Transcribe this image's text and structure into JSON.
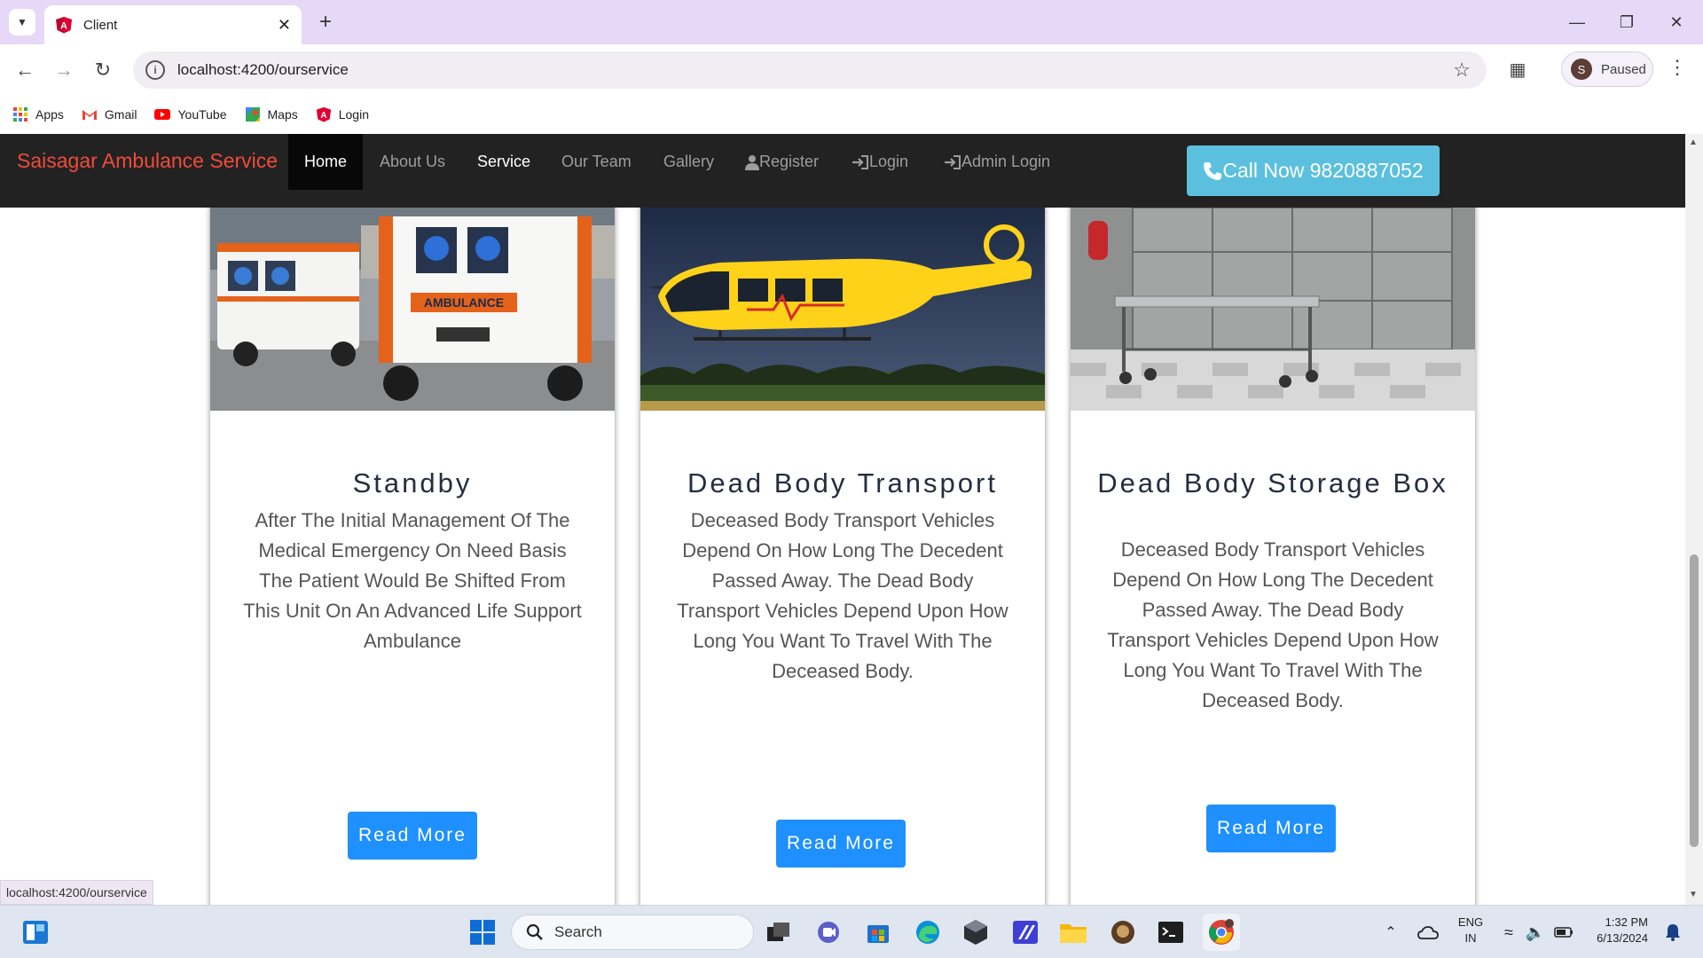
{
  "browser": {
    "tab_title": "Client",
    "url": "localhost:4200/ourservice",
    "profile_initial": "S",
    "profile_status": "Paused",
    "bookmarks": [
      {
        "label": "Apps",
        "icon": "apps-grid-icon"
      },
      {
        "label": "Gmail",
        "icon": "gmail-icon"
      },
      {
        "label": "YouTube",
        "icon": "youtube-icon"
      },
      {
        "label": "Maps",
        "icon": "maps-icon"
      },
      {
        "label": "Login",
        "icon": "angular-icon"
      }
    ],
    "status_url": "localhost:4200/ourservice"
  },
  "navbar": {
    "brand": "Saisagar Ambulance Service",
    "links": [
      {
        "label": "Home"
      },
      {
        "label": "About Us"
      },
      {
        "label": "Service"
      },
      {
        "label": "Our Team"
      },
      {
        "label": "Gallery"
      },
      {
        "label": "Register",
        "icon": "user-icon"
      },
      {
        "label": "Login",
        "icon": "login-icon"
      },
      {
        "label": "Admin Login",
        "icon": "login-icon"
      }
    ],
    "call_label": "Call Now 9820887052"
  },
  "cards": [
    {
      "title": "Standby",
      "description": "After The Initial Management Of The Medical Emergency On Need Basis The Patient Would Be Shifted From This Unit On An Advanced Life Support Ambulance",
      "button": "Read More",
      "image": "ambulance-photo"
    },
    {
      "title": "Dead Body Transport",
      "description": "Deceased Body Transport Vehicles Depend On How Long The Decedent Passed Away. The Dead Body Transport Vehicles Depend Upon How Long You Want To Travel With The Deceased Body.",
      "button": "Read More",
      "image": "helicopter-photo"
    },
    {
      "title": "Dead Body Storage Box",
      "description": "Deceased Body Transport Vehicles Depend On How Long The Decedent Passed Away. The Dead Body Transport Vehicles Depend Upon How Long You Want To Travel With The Deceased Body.",
      "button": "Read More",
      "image": "morgue-storage-photo"
    }
  ],
  "taskbar": {
    "search_label": "Search",
    "lang_top": "ENG",
    "lang_bottom": "IN",
    "time": "1:32 PM",
    "date": "6/13/2024"
  },
  "colors": {
    "brand": "#f04b3a",
    "navbar_bg": "#222222",
    "call_button": "#5bc0de",
    "read_more": "#1e90ff",
    "tabbar": "#e8d8f8"
  }
}
